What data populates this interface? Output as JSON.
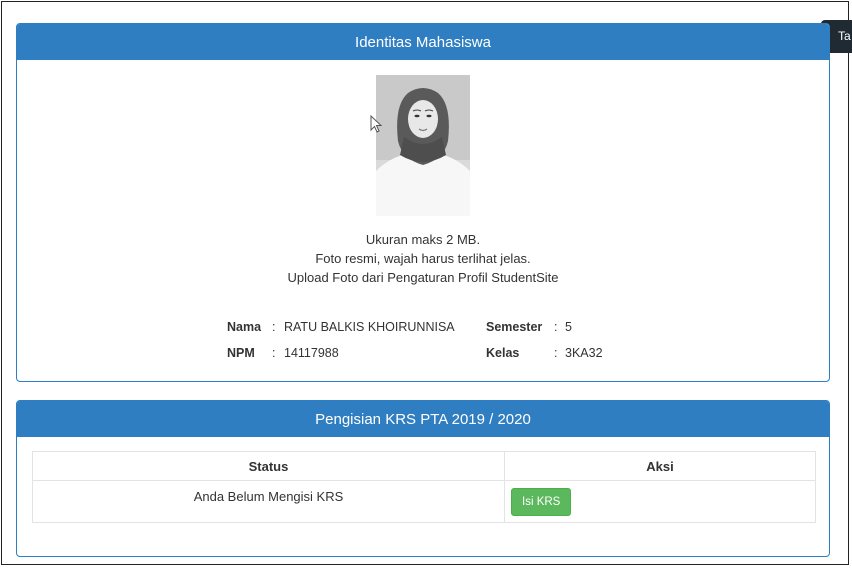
{
  "identity": {
    "header": "Identitas Mahasiswa",
    "photo_notes": [
      "Ukuran maks 2 MB.",
      "Foto resmi, wajah harus terlihat jelas.",
      "Upload Foto dari Pengaturan Profil StudentSite"
    ],
    "fields": {
      "nama": {
        "label": "Nama",
        "colon": ":",
        "value": "RATU BALKIS KHOIRUNNISA"
      },
      "npm": {
        "label": "NPM",
        "colon": ":",
        "value": "14117988"
      },
      "semester": {
        "label": "Semester",
        "colon": ":",
        "value": "5"
      },
      "kelas": {
        "label": "Kelas",
        "colon": ":",
        "value": "3KA32"
      }
    }
  },
  "krs": {
    "header": "Pengisian KRS PTA 2019 / 2020",
    "columns": [
      "Status",
      "Aksi"
    ],
    "rows": [
      {
        "status": "Anda Belum Mengisi KRS",
        "action_label": "Isi KRS"
      }
    ]
  },
  "tooltip": {
    "text": "Ta"
  },
  "colors": {
    "panel_header": "#2f7ec1",
    "action_button": "#5cb85c",
    "tooltip_bg": "#1f2a33"
  },
  "icons": {
    "cursor": "mouse-pointer-icon"
  }
}
